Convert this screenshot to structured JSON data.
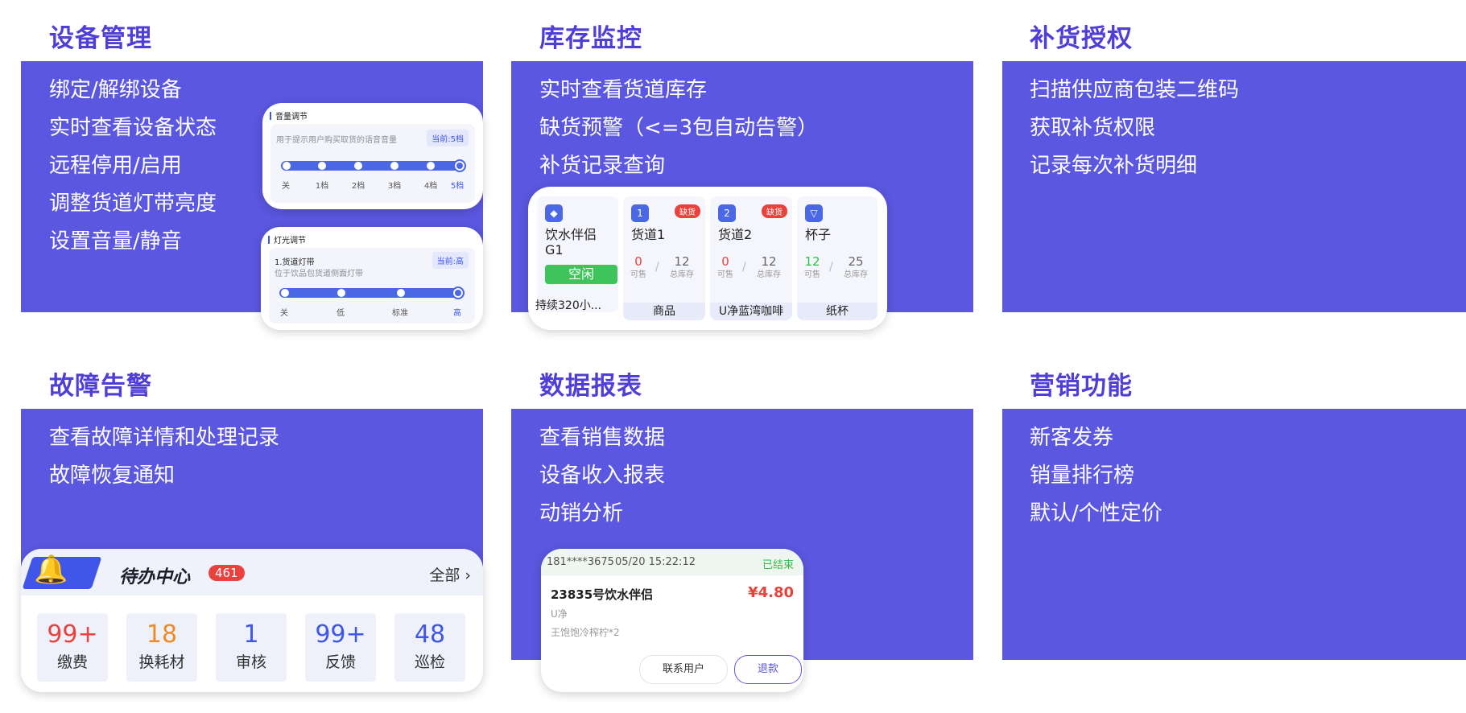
{
  "sections": {
    "device": {
      "title": "设备管理",
      "features": [
        "绑定/解绑设备",
        "实时查看设备状态",
        "远程停用/启用",
        "调整货道灯带亮度",
        "设置音量/静音"
      ]
    },
    "inventory": {
      "title": "库存监控",
      "features": [
        "实时查看货道库存",
        "缺货预警（<=3包自动告警）",
        "补货记录查询"
      ]
    },
    "restock": {
      "title": "补货授权",
      "features": [
        "扫描供应商包装二维码",
        "获取补货权限",
        "记录每次补货明细"
      ]
    },
    "fault": {
      "title": "故障告警",
      "features": [
        "查看故障详情和处理记录",
        "故障恢复通知"
      ]
    },
    "report": {
      "title": "数据报表",
      "features": [
        "查看销售数据",
        "设备收入报表",
        "动销分析"
      ]
    },
    "marketing": {
      "title": "营销功能",
      "features": [
        "新客发券",
        "销量排行榜",
        "默认/个性定价"
      ]
    }
  },
  "volume_card": {
    "title": "音量调节",
    "desc": "用于提示用户购买取货的语音音量",
    "current": "当前:5档",
    "ticks": [
      "关",
      "1档",
      "2档",
      "3档",
      "4档",
      "5档"
    ],
    "selected_index": 5
  },
  "light_card": {
    "title": "灯光调节",
    "item_title": "1.货道灯带",
    "item_desc": "位于饮品包货道侧面灯带",
    "current": "当前:高",
    "ticks": [
      "关",
      "低",
      "标准",
      "高"
    ],
    "selected_index": 3
  },
  "inventory_card": {
    "device": {
      "name": "饮水伴侣",
      "name2": "G1",
      "status": "空闲",
      "footer": "持续320小..."
    },
    "lanes": [
      {
        "name": "货道1",
        "badge": "缺货",
        "icon_text": "1",
        "available": "0",
        "total": "12",
        "available_label": "可售",
        "total_label": "总库存",
        "footer": "商品",
        "available_color": "#e9413b"
      },
      {
        "name": "货道2",
        "badge": "缺货",
        "icon_text": "2",
        "available": "0",
        "total": "12",
        "available_label": "可售",
        "total_label": "总库存",
        "footer": "U净蓝湾咖啡",
        "available_color": "#e9413b"
      },
      {
        "name": "杯子",
        "badge": "",
        "icon_text": "",
        "available": "12",
        "total": "25",
        "available_label": "可售",
        "total_label": "总库存",
        "footer": "纸杯",
        "available_color": "#2fbf4a"
      }
    ]
  },
  "todo_card": {
    "title": "待办中心",
    "count": "461",
    "all_label": "全部",
    "items": [
      {
        "num": "99+",
        "label": "缴费",
        "color": "#e9413b"
      },
      {
        "num": "18",
        "label": "换耗材",
        "color": "#f08a24"
      },
      {
        "num": "1",
        "label": "审核",
        "color": "#3f56e8"
      },
      {
        "num": "99+",
        "label": "反馈",
        "color": "#3f56e8"
      },
      {
        "num": "48",
        "label": "巡检",
        "color": "#3f56e8"
      }
    ]
  },
  "order_card": {
    "phone": "181****3675",
    "time": "05/20 15:22:12",
    "state": "已结束",
    "name": "23835号饮水伴侣",
    "price": "¥4.80",
    "brand": "U净",
    "item": "王饱饱冷榨柠*2",
    "contact_button": "联系用户",
    "refund_button": "退款"
  },
  "colors": {
    "panel": "#5b57e0",
    "title": "#4f3fd6",
    "accent": "#3f56e8",
    "alert": "#e9413b",
    "ok": "#2fbf4a"
  }
}
